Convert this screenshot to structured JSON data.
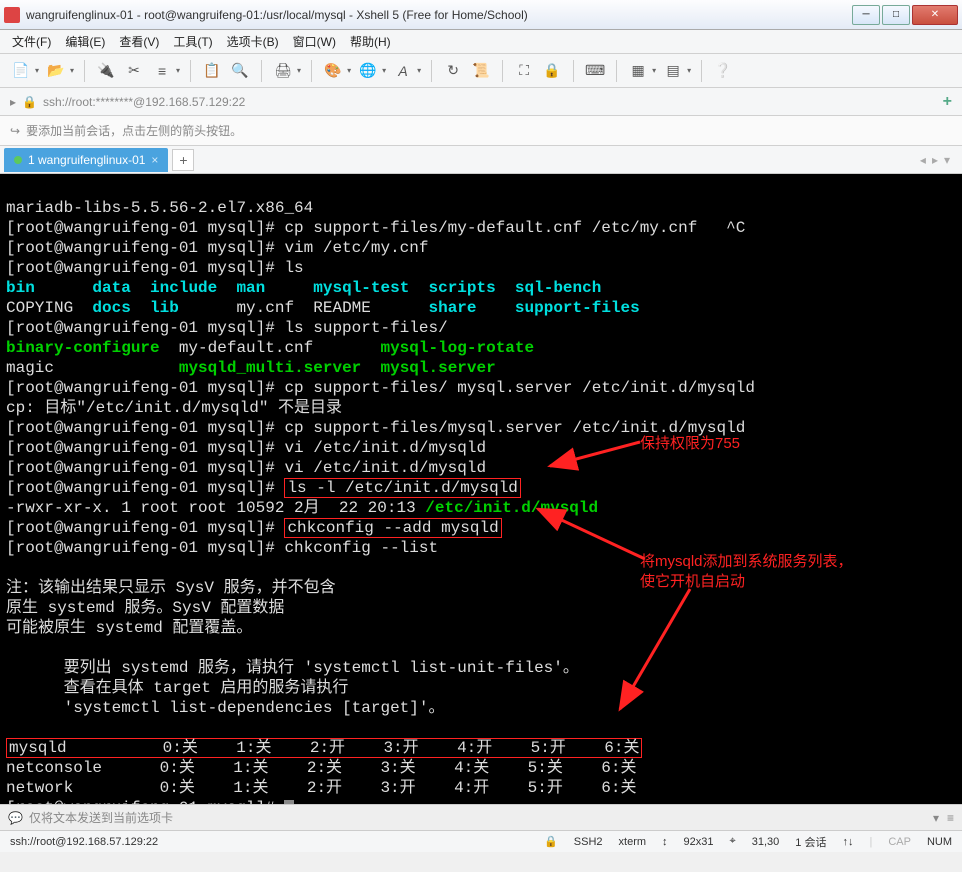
{
  "title": "wangruifenglinux-01 - root@wangruifeng-01:/usr/local/mysql - Xshell 5 (Free for Home/School)",
  "menu": {
    "file": "文件(F)",
    "edit": "编辑(E)",
    "view": "查看(V)",
    "tools": "工具(T)",
    "tabs": "选项卡(B)",
    "window": "窗口(W)",
    "help": "帮助(H)"
  },
  "address": "ssh://root:********@192.168.57.129:22",
  "infobar": "要添加当前会话，点击左侧的箭头按钮。",
  "tab": {
    "label": "1 wangruifenglinux-01"
  },
  "term": {
    "l1": "mariadb-libs-5.5.56-2.el7.x86_64",
    "prompt": "[root@wangruifeng-01 mysql]#",
    "cmd2": " cp support-files/my-default.cnf /etc/my.cnf   ^C",
    "cmd3": " vim /etc/my.cnf",
    "cmd4": " ls",
    "ls_bin": "bin",
    "ls_data": "data",
    "ls_include": "include",
    "ls_man": "man",
    "ls_mysql_test": "mysql-test",
    "ls_scripts": "scripts",
    "ls_sql_bench": "sql-bench",
    "ls_copying": "COPYING",
    "ls_docs": "docs",
    "ls_lib": "lib",
    "ls_mycnf": "my.cnf",
    "ls_readme": "README",
    "ls_share": "share",
    "ls_support": "support-files",
    "cmd5": " ls support-files/",
    "sf_binary": "binary-configure",
    "sf_mydef": "my-default.cnf",
    "sf_logrot": "mysql-log-rotate",
    "sf_magic": "magic",
    "sf_multi": "mysqld_multi.server",
    "sf_server": "mysql.server",
    "cmd6": " cp support-files/ mysql.server /etc/init.d/mysqld",
    "cp_err": "cp: 目标\"/etc/init.d/mysqld\" 不是目录",
    "cmd7": " cp support-files/mysql.server /etc/init.d/mysqld",
    "cmd8": " vi /etc/init.d/mysqld",
    "cmd9": " vi /etc/init.d/mysqld",
    "cmd10a": " ",
    "cmd10b": "ls -l /etc/init.d/mysqld",
    "lsres_a": "-rwxr-xr-x. 1 root root 10592 2月  22 20:13 ",
    "lsres_b": "/etc/init.d/mysqld",
    "cmd11a": " ",
    "cmd11b": "chkconfig --add mysqld",
    "cmd12": " chkconfig --list",
    "note1": "注：该输出结果只显示 SysV 服务，并不包含",
    "note2": "原生 systemd 服务。SysV 配置数据",
    "note3": "可能被原生 systemd 配置覆盖。",
    "note4": "      要列出 systemd 服务，请执行 'systemctl list-unit-files'。",
    "note5": "      查看在具体 target 启用的服务请执行",
    "note6": "      'systemctl list-dependencies [target]'。",
    "svc_mysqld": "mysqld          0:关    1:关    2:开    3:开    4:开    5:开    6:关",
    "svc_netconsole": "netconsole      0:关    1:关    2:关    3:关    4:关    5:关    6:关",
    "svc_network": "network         0:关    1:关    2:开    3:开    4:开    5:开    6:关"
  },
  "annotations": {
    "a1": "保持权限为755",
    "a2": "将mysqld添加到系统服务列表，",
    "a2b": "使它开机自启动"
  },
  "sendbar": "仅将文本发送到当前选项卡",
  "status": {
    "left": "ssh://root@192.168.57.129:22",
    "ssh": "SSH2",
    "term": "xterm",
    "size": "92x31",
    "pos": "31,30",
    "sess": "1 会话",
    "cap": "CAP",
    "num": "NUM"
  }
}
